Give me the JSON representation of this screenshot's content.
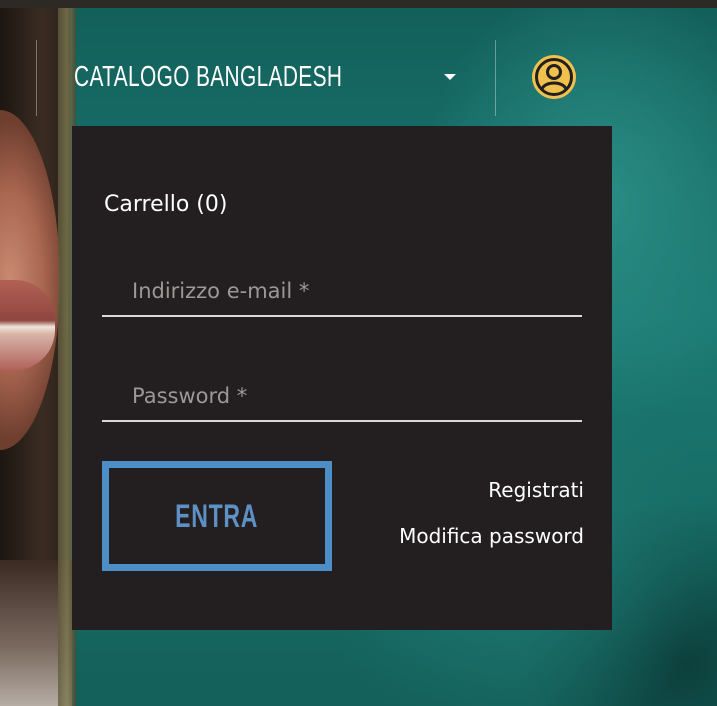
{
  "header": {
    "catalog_label": "CATALOGO BANGLADESH"
  },
  "colors": {
    "panel_bg": "#231f20",
    "accent_blue": "#4d8ec6",
    "user_icon": "#f1c14d"
  },
  "icons": {
    "user": "user-circle-icon",
    "caret": "chevron-down-icon"
  },
  "login_panel": {
    "cart_label": "Carrello (0)",
    "email_placeholder": "Indirizzo e-mail *",
    "email_value": "",
    "password_placeholder": "Password *",
    "password_value": "",
    "login_button": "ENTRA",
    "register_link": "Registrati",
    "reset_password_link": "Modifica password"
  }
}
